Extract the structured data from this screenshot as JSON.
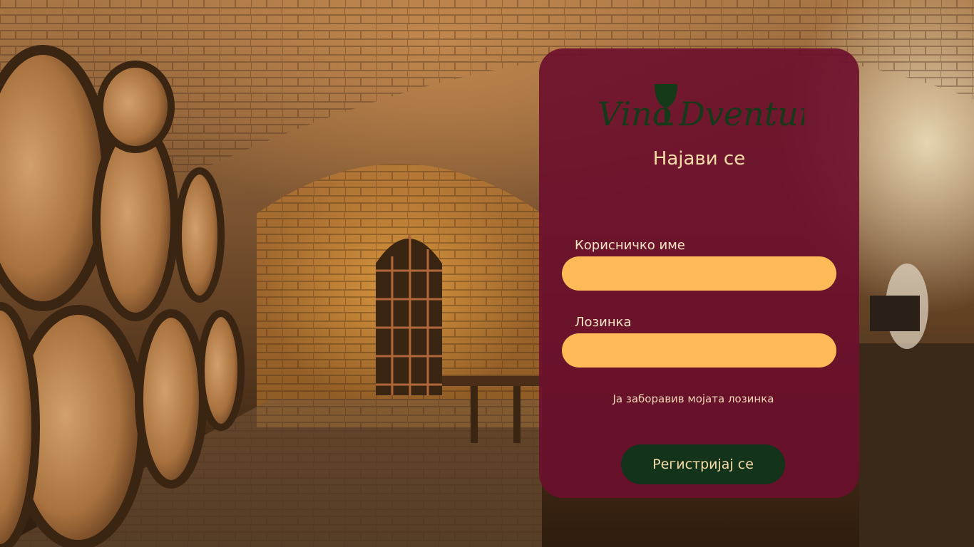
{
  "brand": {
    "logo_text_left": "Vino",
    "logo_text_right": "Dventura",
    "logo_color": "#143a1a"
  },
  "login": {
    "title": "Најави се",
    "username_label": "Корисничко име",
    "username_value": "",
    "password_label": "Лозинка",
    "password_value": "",
    "forgot_password": "Ја заборавив мојата лозинка",
    "register_button": "Регистријај се"
  },
  "colors": {
    "panel": "#6c0e2c",
    "input": "#ffba58",
    "button": "#13331a",
    "text": "#f6dca9"
  },
  "icons": [
    "wine-glass-icon"
  ]
}
